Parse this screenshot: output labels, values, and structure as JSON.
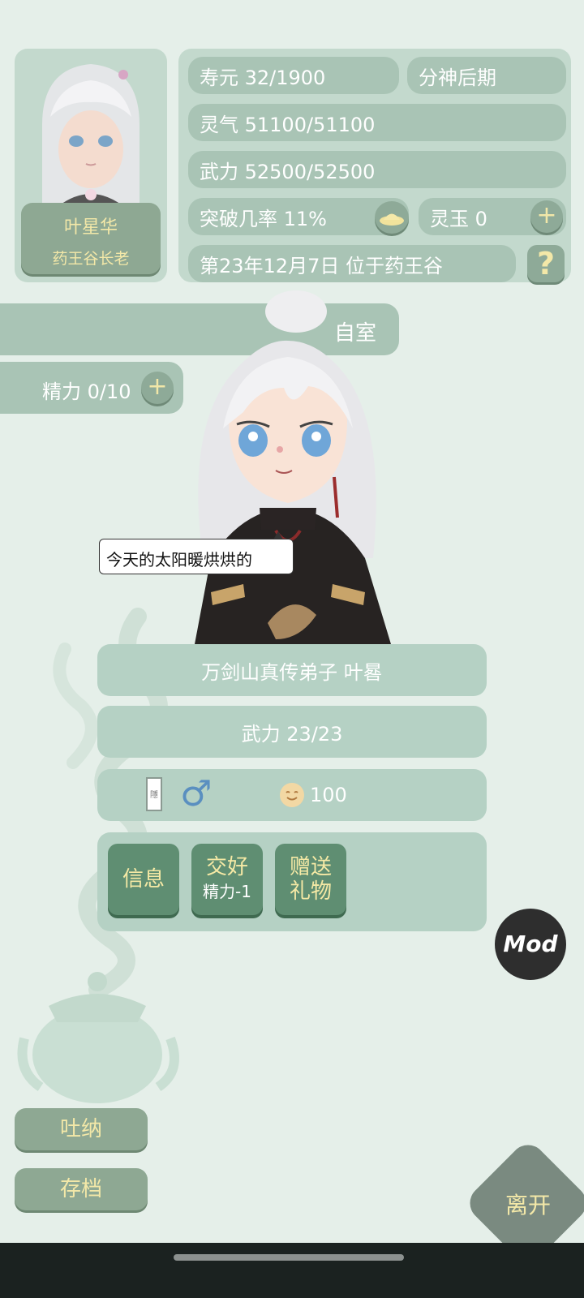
{
  "profile": {
    "name": "叶星华",
    "title": "药王谷长老"
  },
  "stats": {
    "lifespan": "寿元 32/1900",
    "realm": "分神后期",
    "qi": "灵气 51100/51100",
    "force": "武力 52500/52500",
    "breakthrough": "突破几率 11%",
    "spirit_jade": "灵玉 0",
    "date_location": "第23年12月7日 位于药王谷",
    "help_symbol": "?",
    "plus_symbol": "+"
  },
  "location": {
    "room_label": "自室"
  },
  "energy": {
    "label": "精力 0/10",
    "plus_symbol": "+"
  },
  "npc": {
    "speech": "今天的太阳暖烘烘的",
    "name_title": "万剑山真传弟子 叶晷",
    "force": "武力 23/23",
    "mood_value": "100",
    "card_text": "隱",
    "gender_symbol": "♂"
  },
  "actions": {
    "info": "信息",
    "befriend": "交好",
    "befriend_cost": "精力-1",
    "gift_line1": "赠送",
    "gift_line2": "礼物"
  },
  "mod_label": "Mod",
  "sidebar": {
    "meditate": "吐纳",
    "save": "存档"
  },
  "leave_label": "离开",
  "colors": {
    "background": "#e5efe9",
    "pill": "#a9c4b5",
    "action_button": "#5f8e72",
    "accent_text": "#f3e8a8"
  }
}
